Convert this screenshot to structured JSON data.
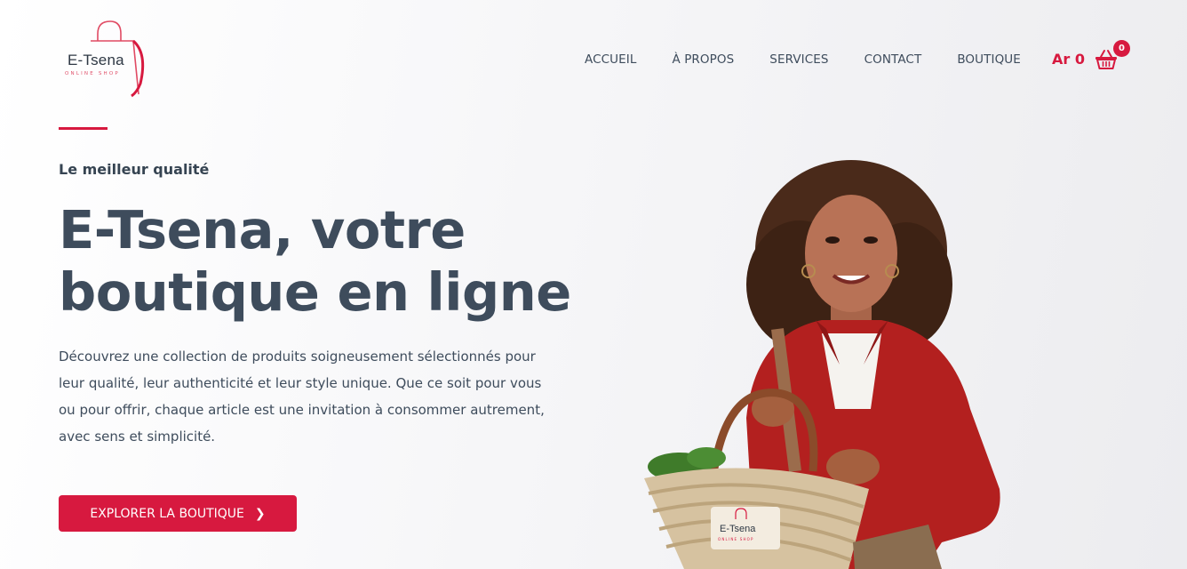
{
  "brand": {
    "name": "E-Tsena",
    "tagline": "ONLINE SHOP"
  },
  "nav": {
    "items": [
      {
        "label": "ACCUEIL"
      },
      {
        "label": "À PROPOS"
      },
      {
        "label": "SERVICES"
      },
      {
        "label": "CONTACT"
      },
      {
        "label": "BOUTIQUE"
      }
    ]
  },
  "cart": {
    "total": "Ar 0",
    "count": "0",
    "icon": "basket-icon"
  },
  "hero": {
    "kicker": "Le meilleur qualité",
    "headline_line1": "E-Tsena, votre",
    "headline_line2": "boutique en ligne",
    "description": "Découvrez une collection de produits soigneusement sélectionnés pour leur qualité, leur authenticité et leur style unique. Que ce soit pour vous ou pour offrir, chaque article est une invitation à consommer autrement, avec sens et simplicité.",
    "cta_label": "EXPLORER LA BOUTIQUE",
    "cta_icon": "chevron-right-icon",
    "basket_logo": {
      "name": "E-Tsena",
      "tagline": "ONLINE SHOP"
    }
  },
  "colors": {
    "accent": "#d7193f",
    "text": "#3e4c5c"
  }
}
